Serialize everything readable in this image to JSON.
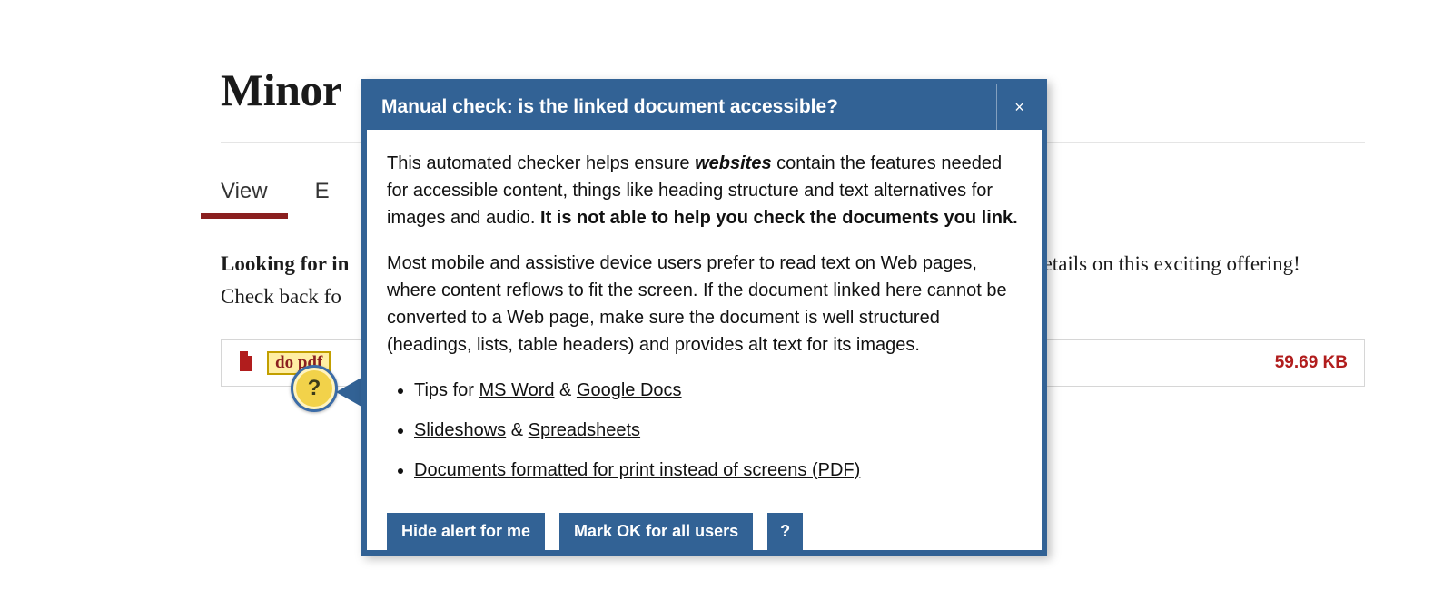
{
  "page": {
    "title_partial": "Minor",
    "tabs": {
      "view": "View",
      "edit_partial": "E"
    },
    "intro_lead": "Looking for in",
    "intro_trail": "letails on this exciting offering!",
    "intro_line2": "Check back fo"
  },
  "file": {
    "name_partial": "do        pdf",
    "size": "59.69 KB"
  },
  "qmark": "?",
  "dialog": {
    "title": "Manual check: is the linked document accessible?",
    "close": "×",
    "p1_a": "This automated checker helps ensure ",
    "p1_em": "websites",
    "p1_b": " contain the features needed for accessible content, things like heading structure and text alternatives for images and audio. ",
    "p1_strong": "It is not able to help you check the documents you link.",
    "p2": "Most mobile and assistive device users prefer to read text on Web pages, where content reflows to fit the screen. If the document linked here cannot be converted to a Web page, make sure the document is well structured (headings, lists, table headers) and provides alt text for its images.",
    "li1_a": "Tips for ",
    "li1_link1": "MS Word",
    "li1_b": " & ",
    "li1_link2": "Google Docs",
    "li2_link1": "Slideshows",
    "li2_b": " & ",
    "li2_link2": "Spreadsheets",
    "li3_link": "Documents formatted for print instead of screens (PDF)",
    "actions": {
      "hide": "Hide alert for me",
      "mark_ok": "Mark OK for all users",
      "help": "?"
    }
  }
}
